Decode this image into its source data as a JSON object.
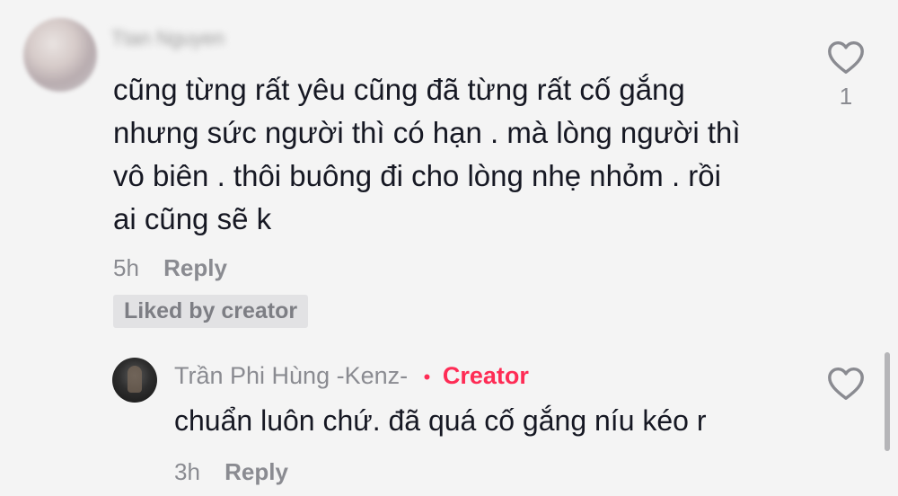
{
  "comment": {
    "username_blurred": "Ttan Nguyen",
    "text_lines": [
      "cũng từng rất yêu cũng đã từng rất cố gắng",
      "nhưng sức người thì có hạn . mà lòng người thì",
      "vô biên . thôi buông đi cho lòng nhẹ nhỏm . rồi",
      "ai cũng sẽ k"
    ],
    "time": "5h",
    "reply_label": "Reply",
    "liked_badge": "Liked by creator",
    "like_count": "1"
  },
  "reply": {
    "author": "Trần Phi Hùng -Kenz-",
    "separator": "•",
    "creator_label": "Creator",
    "text": "chuẩn luôn chứ. đã quá cố gắng níu kéo r",
    "time": "3h",
    "reply_label": "Reply"
  },
  "colors": {
    "background": "#f4f4f4",
    "creator_accent": "#fe2c55",
    "muted_text": "#8a8b91"
  },
  "icons": {
    "like": "heart-outline-icon"
  }
}
